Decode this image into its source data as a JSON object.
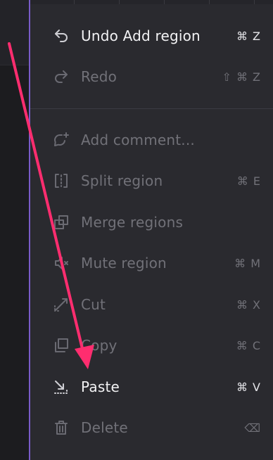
{
  "menu": {
    "items": [
      {
        "label": "Undo Add region",
        "shortcut": "⌘ Z",
        "icon": "undo-icon",
        "enabled": true
      },
      {
        "label": "Redo",
        "shortcut": "⇧ ⌘ Z",
        "icon": "redo-icon",
        "enabled": false
      },
      {
        "label": "Add comment...",
        "shortcut": "",
        "icon": "add-comment-icon",
        "enabled": false
      },
      {
        "label": "Split region",
        "shortcut": "⌘ E",
        "icon": "split-icon",
        "enabled": false
      },
      {
        "label": "Merge regions",
        "shortcut": "",
        "icon": "merge-icon",
        "enabled": false
      },
      {
        "label": "Mute region",
        "shortcut": "⌘ M",
        "icon": "mute-icon",
        "enabled": false
      },
      {
        "label": "Cut",
        "shortcut": "⌘ X",
        "icon": "cut-icon",
        "enabled": false
      },
      {
        "label": "Copy",
        "shortcut": "⌘ C",
        "icon": "copy-icon",
        "enabled": false
      },
      {
        "label": "Paste",
        "shortcut": "⌘ V",
        "icon": "paste-icon",
        "enabled": true
      },
      {
        "label": "Delete",
        "shortcut": "⌫",
        "icon": "trash-icon",
        "enabled": false
      }
    ]
  },
  "colors": {
    "menu_bg": "#2a2a2f",
    "accent_border": "#7a5cc9",
    "annotation_arrow": "#ff2d6f",
    "enabled_text": "#f2f2f4",
    "disabled_text": "#717178"
  }
}
